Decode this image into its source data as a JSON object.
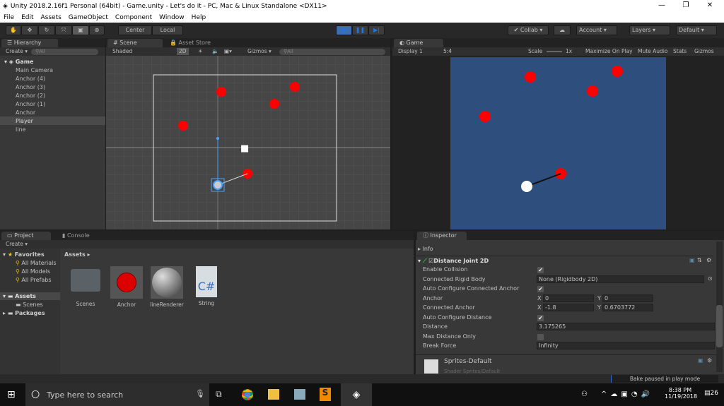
{
  "window": {
    "title": "Unity 2018.2.16f1 Personal (64bit) - Game.unity - Let's do it - PC, Mac & Linux Standalone <DX11>"
  },
  "menu": [
    "File",
    "Edit",
    "Assets",
    "GameObject",
    "Component",
    "Window",
    "Help"
  ],
  "toolbar": {
    "center": "Center",
    "local": "Local",
    "collab": "Collab",
    "account": "Account",
    "layers": "Layers",
    "layout": "Default"
  },
  "hierarchy": {
    "tab": "Hierarchy",
    "create": "Create",
    "search": "All",
    "scene": "Game",
    "items": [
      "Main Camera",
      "Anchor (4)",
      "Anchor (3)",
      "Anchor (2)",
      "Anchor (1)",
      "Anchor",
      "Player",
      "line"
    ]
  },
  "scene": {
    "tab": "Scene",
    "tab2": "Asset Store",
    "shading": "Shaded",
    "mode2d": "2D",
    "gizmos": "Gizmos",
    "search": "All"
  },
  "game": {
    "tab": "Game",
    "display": "Display 1",
    "aspect": "5:4",
    "scale_label": "Scale",
    "scale": "1x",
    "maximize": "Maximize On Play",
    "mute": "Mute Audio",
    "stats": "Stats",
    "gizmos": "Gizmos",
    "background": "#2e4e7e"
  },
  "project": {
    "tab": "Project",
    "tab2": "Console",
    "create": "Create",
    "favorites": "Favorites",
    "fav_items": [
      "All Materials",
      "All Models",
      "All Prefabs"
    ],
    "assets": "Assets",
    "scenes": "Scenes",
    "packages": "Packages",
    "breadcrumb": "Assets",
    "files": [
      {
        "name": "Scenes",
        "icon": "folder-icon"
      },
      {
        "name": "Anchor",
        "icon": "sprite-icon"
      },
      {
        "name": "lineRenderer",
        "icon": "material-icon"
      },
      {
        "name": "String",
        "icon": "csharp-icon"
      }
    ]
  },
  "inspector": {
    "tab": "Inspector",
    "info": "Info",
    "component": "Distance Joint 2D",
    "rows": {
      "enable_collision": "Enable Collision",
      "connected_rb": "Connected Rigid Body",
      "auto_anchor": "Auto Configure Connected Anchor",
      "anchor": "Anchor",
      "connected_anchor": "Connected Anchor",
      "auto_distance": "Auto Configure Distance",
      "distance": "Distance",
      "max_only": "Max Distance Only",
      "break_force": "Break Force"
    },
    "values": {
      "connected_rb": "None (Rigidbody 2D)",
      "anchor_x": "0",
      "anchor_y": "0",
      "ca_x": "-1.8",
      "ca_y": "0.6703772",
      "distance": "3.175265",
      "break_force": "Infinity",
      "x": "X",
      "y": "Y"
    },
    "material": "Sprites-Default",
    "shader_label": "Shader",
    "shader": "Sprites/Default"
  },
  "status": "Bake paused in play mode",
  "taskbar": {
    "search": "Type here to search",
    "time": "8:38 PM",
    "date": "11/19/2018",
    "notifications": "26"
  }
}
